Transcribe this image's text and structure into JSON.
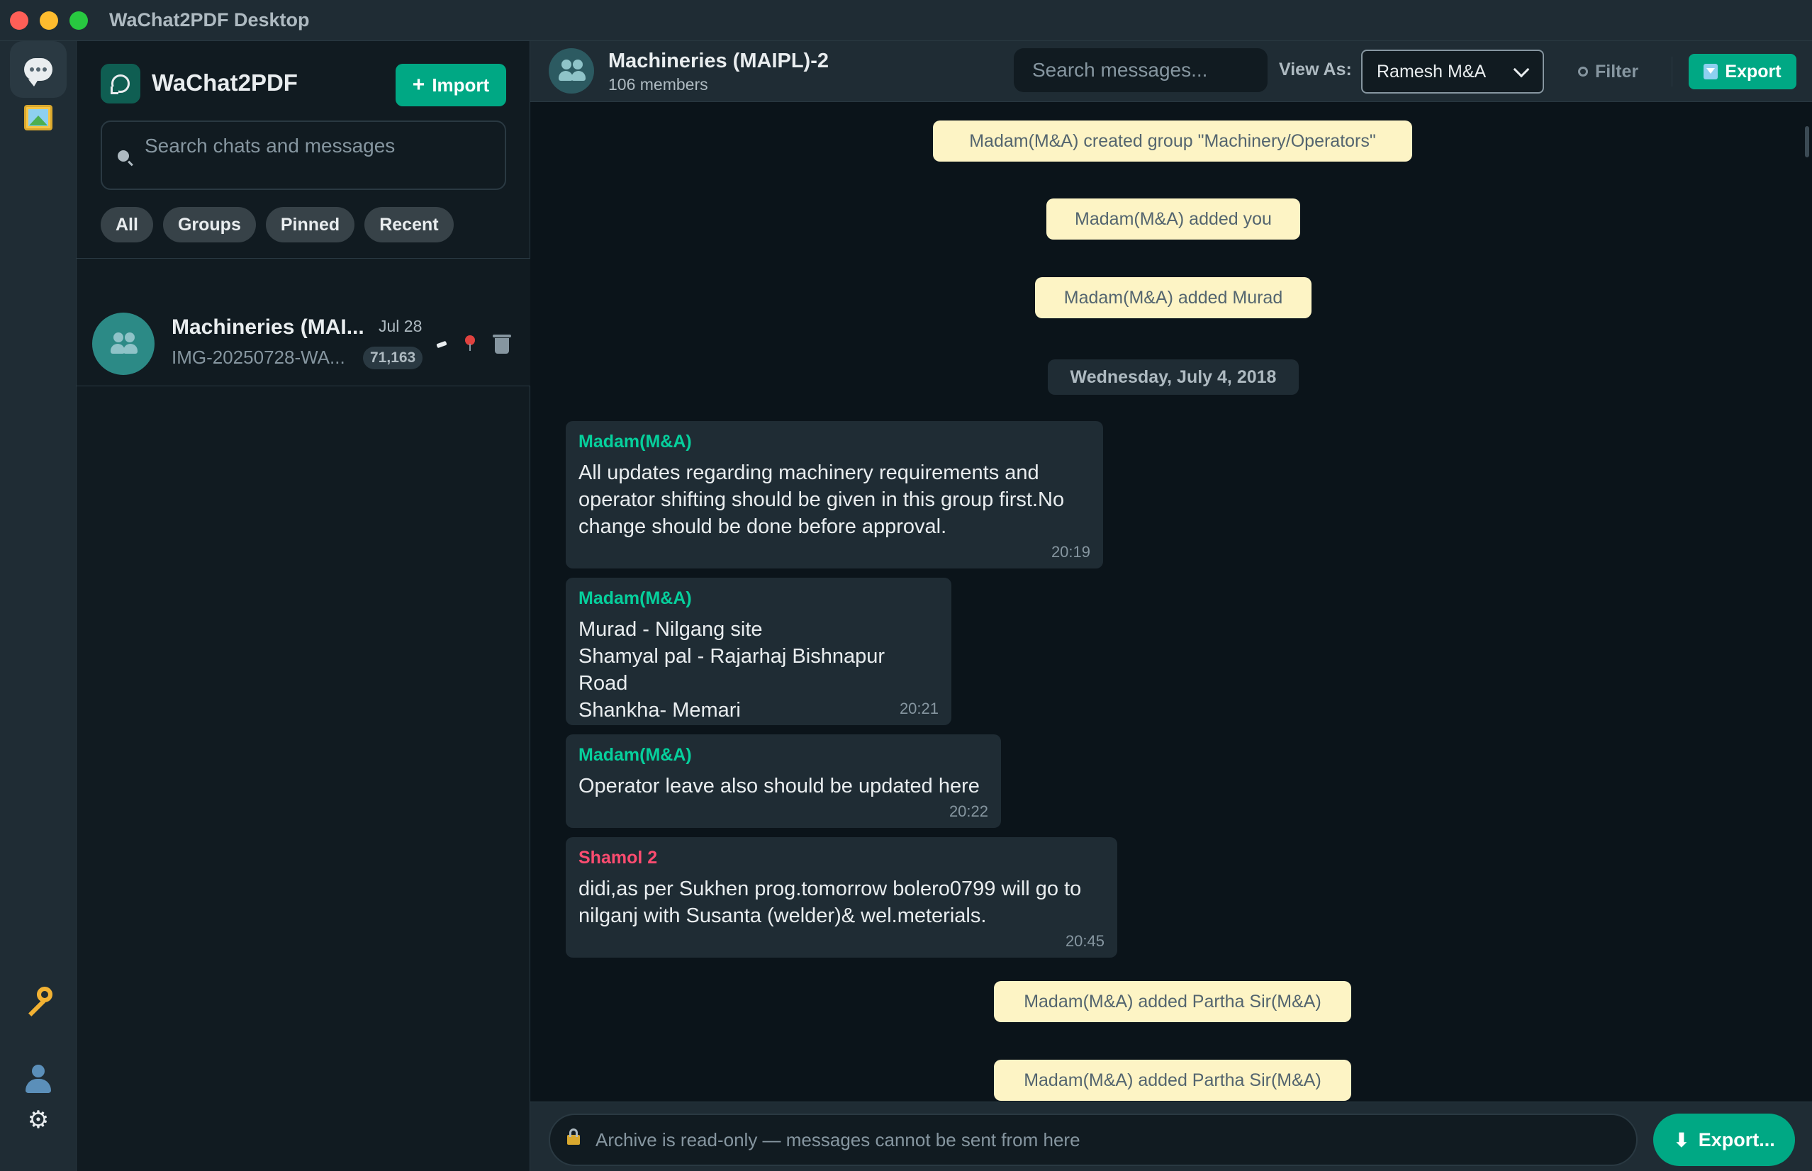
{
  "window": {
    "title": "WaChat2PDF Desktop"
  },
  "rail": {
    "items": [
      {
        "icon": "chat-bubble-icon",
        "active": true
      },
      {
        "icon": "picture-icon",
        "active": false
      },
      {
        "icon": "key-icon",
        "active": false
      },
      {
        "icon": "user-icon",
        "active": false
      },
      {
        "icon": "gear-icon",
        "active": false
      }
    ],
    "gear_glyph": "⚙"
  },
  "sidebar": {
    "brand": "WaChat2PDF",
    "import_label": "Import",
    "import_plus": "+",
    "search_placeholder": "Search chats and messages",
    "filters": [
      "All",
      "Groups",
      "Pinned",
      "Recent"
    ],
    "chats": [
      {
        "name": "Machineries (MAI...",
        "date": "Jul 28",
        "preview": "IMG-20250728-WA...",
        "count": "71,163"
      }
    ]
  },
  "header": {
    "title": "Machineries (MAIPL)-2",
    "members": "106 members",
    "search_placeholder": "Search messages...",
    "view_as_label": "View As:",
    "view_as_value": "Ramesh M&A",
    "filter_label": "Filter",
    "export_label": "Export"
  },
  "messages": {
    "system": [
      "Madam(M&A) created group \"Machinery/Operators\"",
      "Madam(M&A) added you",
      "Madam(M&A) added Murad",
      "Madam(M&A) added Partha Sir(M&A)",
      "Madam(M&A) added Partha Sir(M&A)"
    ],
    "date_divider": "Wednesday, July 4, 2018",
    "items": [
      {
        "sender": "Madam(M&A)",
        "text": "All updates regarding machinery requirements and\noperator shifting should be given in this group first.No\nchange should be done before approval.",
        "time": "20:19"
      },
      {
        "sender": "Madam(M&A)",
        "text": "Murad - Nilgang site\nShamyal pal - Rajarhaj Bishnapur Road\nShankha- Memari",
        "time": "20:21"
      },
      {
        "sender": "Madam(M&A)",
        "text": "Operator leave also should be updated here",
        "time": "20:22"
      },
      {
        "sender": "Shamol 2",
        "text": "didi,as per Sukhen prog.tomorrow bolero0799 will go to\nnilganj with Susanta  (welder)& wel.meterials.",
        "time": "20:45"
      }
    ]
  },
  "composer": {
    "readonly_text": "Archive is read-only — messages cannot be sent from here",
    "export_label": "Export...",
    "export_arrow": "⬇"
  },
  "colors": {
    "accent": "#00a884",
    "sender_green": "#06cf9c",
    "sender_red": "#fc4c70",
    "system_pill": "#fdf4c5"
  }
}
